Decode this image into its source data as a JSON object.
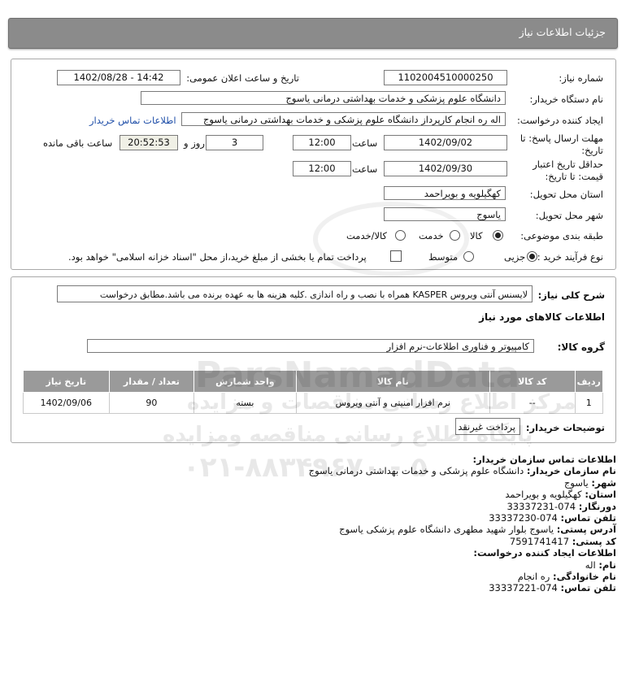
{
  "header": {
    "title": "جزئیات اطلاعات نیاز"
  },
  "form": {
    "need_number_label": "شماره نیاز:",
    "need_number": "1102004510000250",
    "announce_label": "تاریخ و ساعت اعلان عمومی:",
    "announce_value": "1402/08/28 - 14:42",
    "buyer_org_label": "نام دستگاه خریدار:",
    "buyer_org": "دانشگاه علوم پزشکی و خدمات بهداشتی  درمانی یاسوج",
    "requester_label": "ایجاد کننده درخواست:",
    "requester": "اله ره انجام کارپرداز دانشگاه علوم پزشکی و خدمات بهداشتی  درمانی یاسوج",
    "contact_link": "اطلاعات تماس خریدار",
    "deadline_label_1": "مهلت ارسال پاسخ: تا",
    "deadline_label_2": "تاریخ:",
    "deadline_date": "1402/09/02",
    "time_label": "ساعت",
    "deadline_time": "12:00",
    "days_value": "3",
    "days_label": "روز و",
    "remaining_time": "20:52:53",
    "remaining_label": "ساعت باقی مانده",
    "validity_label_1": "حداقل تاریخ اعتبار",
    "validity_label_2": "قیمت: تا تاریخ:",
    "validity_date": "1402/09/30",
    "validity_time": "12:00",
    "province_label": "استان محل تحویل:",
    "province": "کهگیلویه و بویراحمد",
    "city_label": "شهر محل تحویل:",
    "city": "یاسوج",
    "category_label": "طبقه بندی موضوعی:",
    "category_options": [
      "کالا",
      "خدمت",
      "کالا/خدمت"
    ],
    "process_label": "نوع فرآیند خرید :",
    "process_options": [
      "جزیی",
      "متوسط"
    ],
    "treasury_text": "پرداخت تمام یا بخشی از مبلغ خرید،از محل \"اسناد خزانه اسلامی\" خواهد بود."
  },
  "details": {
    "description_label": "شرح کلی نیاز:",
    "description": "لایسنس آنتی ویروس KASPER همراه با نصب و راه اندازی .کلیه هزینه ها به عهده برنده می باشد.مطابق درخواست",
    "goods_info_title": "اطلاعات کالاهای مورد نیاز",
    "goods_group_label": "گروه کالا:",
    "goods_group": "کامپیوتر و فناوری اطلاعات-نرم افزار",
    "table_headers": [
      "ردیف",
      "کد کالا",
      "نام کالا",
      "واحد شمارش",
      "تعداد / مقدار",
      "تاریخ نیاز"
    ],
    "table_rows": [
      [
        "1",
        "--",
        "نرم افزار امنیتی و آنتی ویروس",
        "بسته",
        "90",
        "1402/09/06"
      ]
    ],
    "buyer_notes_label": "توضیحات خریدار:",
    "buyer_notes": "پرداخت غیرنقد"
  },
  "contact": {
    "title": "اطلاعات تماس سازمان خریدار:",
    "org_label": "نام سازمان خریدار:",
    "org": "دانشگاه علوم پزشکی و خدمات بهداشتی درمانی یاسوج",
    "city_label": "شهر:",
    "city": "یاسوج",
    "province_label": "استان:",
    "province": "کهگیلویه و بویراحمد",
    "fax_label": "دورنگار:",
    "fax": "074-33337231",
    "phone_label": "تلفن تماس:",
    "phone": "074-33337230",
    "address_label": "آدرس پستی:",
    "address": "یاسوج بلوار شهید مطهری دانشگاه علوم پزشکی یاسوج",
    "postal_label": "کد پستی:",
    "postal": "7591741417",
    "creator_title": "اطلاعات ایجاد کننده درخواست:",
    "name_label": "نام:",
    "name": "اله",
    "family_label": "نام خانوادگی:",
    "family": "ره انجام",
    "creator_phone_label": "تلفن تماس:",
    "creator_phone": "074-33337221"
  },
  "watermark": {
    "brand": "ParsNamadData",
    "line1": "مرکز اطلاع رسانی مناقصات و مزایده",
    "line2": "پایگاه اطلاع رسانی مناقصه ومزایده",
    "phone": "۰۲۱-۸۸۳۴۹۶۷۰ - ۵"
  }
}
